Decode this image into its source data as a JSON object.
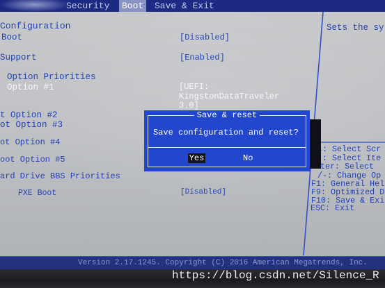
{
  "tabs": [
    {
      "label": "Security",
      "selected": false
    },
    {
      "label": "Boot",
      "selected": true
    },
    {
      "label": "Save & Exit",
      "selected": false
    }
  ],
  "settings": {
    "rows": [
      {
        "label": "Configuration"
      },
      {
        "label": "Boot",
        "value": "[Disabled]"
      },
      {
        "label": "Support",
        "value": "[Enabled]"
      },
      {
        "label": "Option Priorities"
      },
      {
        "label": "Option #1",
        "value_lines": [
          "[UEFI:",
          "KingstonDataTraveler",
          "3.0]"
        ],
        "selected": true
      },
      {
        "label": "t Option #2"
      },
      {
        "label": "ot Option #3"
      },
      {
        "label": "ot Option #4"
      },
      {
        "label": "oot Option #5"
      },
      {
        "label": "ard Drive BBS Priorities"
      },
      {
        "label": "PXE Boot",
        "value": "[Disabled]"
      }
    ]
  },
  "help": {
    "description": "Sets the sy",
    "keys": [
      "←: Select Scr",
      "↓: Select Ite",
      "nter: Select",
      "/-: Change Op",
      "F1: General Hel",
      "F9: Optimized D",
      "F10: Save & Exi",
      "ESC: Exit"
    ]
  },
  "dialog": {
    "title": "Save & reset",
    "message": "Save configuration and reset?",
    "buttons": [
      {
        "label": "Yes",
        "selected": true
      },
      {
        "label": "No",
        "selected": false
      }
    ]
  },
  "footer": {
    "version_text": "Version 2.17.1245. Copyright (C) 2016 American Megatrends, Inc."
  },
  "watermark": "https://blog.csdn.net/Silence_R",
  "colors": {
    "tab_bar": "#1d2a84",
    "tab_text": "#c3cbef",
    "tab_selected": "#8a93c2",
    "text_blue": "#2242b4",
    "text_selected": "#f7f8ff",
    "divider": "#3552c2",
    "dialog_background": "#2347cc",
    "dialog_line": "#e4e9ff",
    "dialog_shadow": "#0f1018",
    "button_selected": "#15161d",
    "footer_background": "#22327e",
    "footer_text": "#8796d2"
  }
}
